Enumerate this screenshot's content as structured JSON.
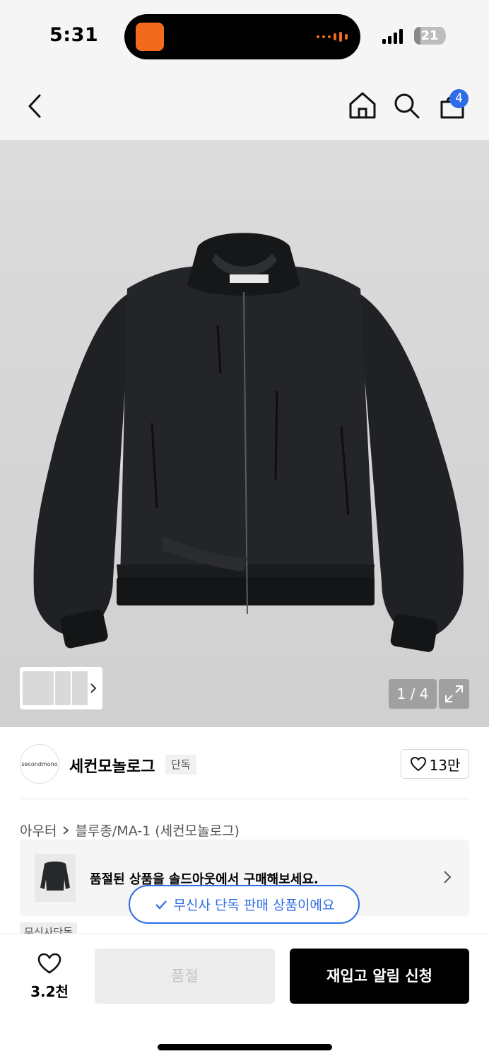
{
  "status_bar": {
    "time": "5:31",
    "battery_level": "21",
    "battery_fraction": 0.21
  },
  "nav": {
    "cart_count": "4"
  },
  "gallery": {
    "counter": "1 / 4"
  },
  "brand": {
    "logo_text": "secondmono",
    "name": "세컨모놀로그",
    "exclusive_tag": "단독",
    "likes": "13만"
  },
  "breadcrumb": {
    "category": "아우터",
    "subcategory": "블루종/MA-1 (세컨모놀로그)"
  },
  "soldout_card": {
    "text": "품절된 상품을 솔드아웃에서 구매해보세요."
  },
  "exclusive_pill": {
    "text": "무신사 단독 판매 상품이에요"
  },
  "partial_tag": "무신사단독",
  "bottom": {
    "wish_count": "3.2천",
    "soldout_label": "품절",
    "restock_label": "재입고 알림 신청"
  },
  "colors": {
    "accent_blue": "#2d6be8",
    "island_orange": "#f26b1d",
    "background": "#f5f5f5"
  }
}
